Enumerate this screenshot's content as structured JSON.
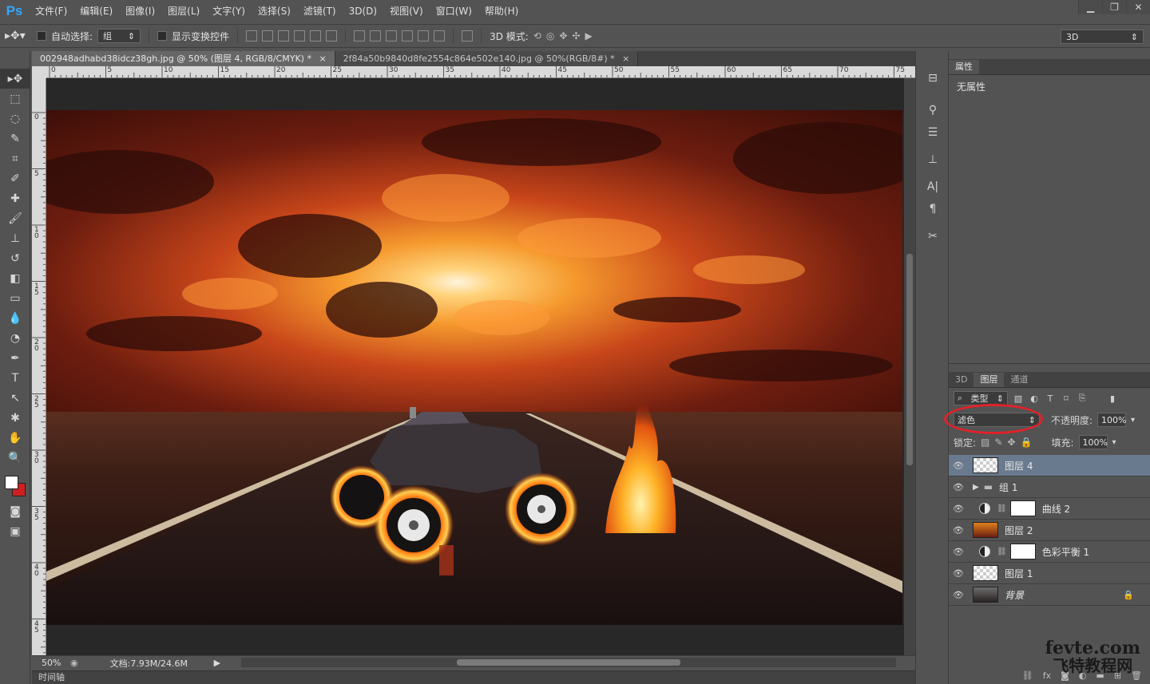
{
  "app": {
    "logo": "Ps"
  },
  "menu": [
    "文件(F)",
    "编辑(E)",
    "图像(I)",
    "图层(L)",
    "文字(Y)",
    "选择(S)",
    "滤镜(T)",
    "3D(D)",
    "视图(V)",
    "窗口(W)",
    "帮助(H)"
  ],
  "window_controls": {
    "minimize": "▁",
    "restore": "❐",
    "close": "✕"
  },
  "options": {
    "auto_select_label": "自动选择:",
    "auto_select_value": "组",
    "show_transform_label": "显示变换控件",
    "mode_3d_label": "3D 模式:",
    "workspace_value": "3D"
  },
  "tabs": [
    {
      "title": "002948adhabd38idcz38gh.jpg @ 50% (图层 4, RGB/8/CMYK) *",
      "close": "×"
    },
    {
      "title": "2f84a50b9840d8fe2554c864e502e140.jpg @ 50%(RGB/8#) *",
      "close": "×"
    }
  ],
  "ruler_top_labels": [
    "0",
    "5",
    "10",
    "15",
    "20",
    "25",
    "30",
    "35",
    "40",
    "45",
    "50",
    "55",
    "60",
    "65",
    "70",
    "75"
  ],
  "ruler_left_labels": [
    "0",
    "5",
    "10",
    "15",
    "20",
    "25",
    "30",
    "35",
    "40",
    "45"
  ],
  "status": {
    "zoom": "50%",
    "doc_info": "文档:7.93M/24.6M"
  },
  "timeline_label": "时间轴",
  "properties": {
    "tab_label": "属性",
    "body_text": "无属性"
  },
  "layers": {
    "tabs": [
      "3D",
      "图层",
      "通道"
    ],
    "filter_kind": "类型",
    "blend_mode": "滤色",
    "opacity_label": "不透明度:",
    "opacity_value": "100%",
    "lock_label": "锁定:",
    "fill_label": "填充:",
    "fill_value": "100%",
    "items": [
      {
        "name": "图层 4",
        "selected": true
      },
      {
        "name": "组 1"
      },
      {
        "name": "曲线 2"
      },
      {
        "name": "图层 2"
      },
      {
        "name": "色彩平衡 1"
      },
      {
        "name": "图层 1"
      },
      {
        "name": "背景"
      }
    ]
  },
  "watermark": {
    "line1": "fevte.com",
    "line2": "飞特教程网"
  }
}
